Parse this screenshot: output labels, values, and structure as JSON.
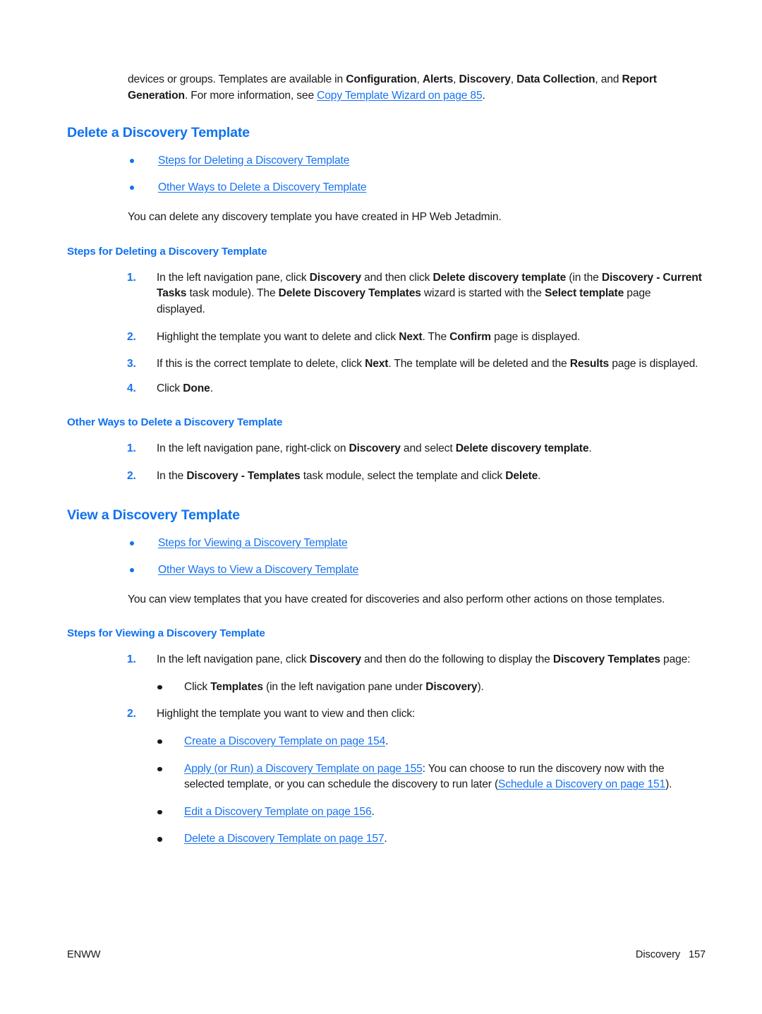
{
  "intro": {
    "line_a_1": "devices or groups. Templates are available in ",
    "b1": "Configuration",
    "sep1": ", ",
    "b2": "Alerts",
    "sep2": ", ",
    "b3": "Discovery",
    "sep3": ", ",
    "b4": "Data Collection",
    "sep4": ", and ",
    "b5": "Report Generation",
    "line_a_2": ". For more information, see ",
    "link": "Copy Template Wizard on page 85",
    "line_a_3": "."
  },
  "section_delete": {
    "heading": "Delete a Discovery Template",
    "toc": [
      "Steps for Deleting a Discovery Template",
      "Other Ways to Delete a Discovery Template"
    ],
    "intro": "You can delete any discovery template you have created in HP Web Jetadmin.",
    "steps_heading": "Steps for Deleting a Discovery Template",
    "steps": [
      {
        "num": "1.",
        "p1": "In the left navigation pane, click ",
        "b1": "Discovery",
        "p2": " and then click ",
        "b2": "Delete discovery template",
        "p3": " (in the ",
        "b3": "Discovery - Current Tasks",
        "p4": " task module). The ",
        "b4": "Delete Discovery Templates",
        "p5": " wizard is started with the ",
        "b5": "Select template",
        "p6": " page displayed."
      },
      {
        "num": "2.",
        "p1": "Highlight the template you want to delete and click ",
        "b1": "Next",
        "p2": ". The ",
        "b2": "Confirm",
        "p3": " page is displayed."
      },
      {
        "num": "3.",
        "p1": "If this is the correct template to delete, click ",
        "b1": "Next",
        "p2": ". The template will be deleted and the ",
        "b2": "Results",
        "p3": " page is displayed."
      },
      {
        "num": "4.",
        "p1": "Click ",
        "b1": "Done",
        "p2": "."
      }
    ],
    "other_ways_heading": "Other Ways to Delete a Discovery Template",
    "other_ways": [
      {
        "num": "1.",
        "p1": "In the left navigation pane, right-click on ",
        "b1": "Discovery",
        "p2": " and select ",
        "b2": "Delete discovery template",
        "p3": "."
      },
      {
        "num": "2.",
        "p1": "In the ",
        "b1": "Discovery - Templates",
        "p2": " task module, select the template and click ",
        "b2": "Delete",
        "p3": "."
      }
    ]
  },
  "section_view": {
    "heading": "View a Discovery Template",
    "toc": [
      "Steps for Viewing a Discovery Template",
      "Other Ways to View a Discovery Template"
    ],
    "intro": "You can view templates that you have created for discoveries and also perform other actions on those templates.",
    "steps_heading": "Steps for Viewing a Discovery Template",
    "step1": {
      "num": "1.",
      "p1": "In the left navigation pane, click ",
      "b1": "Discovery",
      "p2": " and then do the following to display the ",
      "b2": "Discovery Templates",
      "p3": " page:"
    },
    "step1_sub": {
      "p1": "Click ",
      "b1": "Templates",
      "p2": " (in the left navigation pane under ",
      "b2": "Discovery",
      "p3": ")."
    },
    "step2": {
      "num": "2.",
      "text": "Highlight the template you want to view and then click:"
    },
    "step2_sub": [
      {
        "link": "Create a Discovery Template on page 154",
        "tail": "."
      },
      {
        "link": "Apply (or Run) a Discovery Template on page 155",
        "mid1": ": You can choose to run the discovery now with the selected template, or you can schedule the discovery to run later (",
        "link2": "Schedule a Discovery on page 151",
        "tail": ")."
      },
      {
        "link": "Edit a Discovery Template on page 156",
        "tail": "."
      },
      {
        "link": "Delete a Discovery Template on page 157",
        "tail": "."
      }
    ]
  },
  "footer": {
    "left": "ENWW",
    "right": "Discovery   157"
  },
  "colors": {
    "heading_blue": "#1072f0",
    "link_blue": "#1672f2",
    "body_text": "#1a1a1a"
  }
}
